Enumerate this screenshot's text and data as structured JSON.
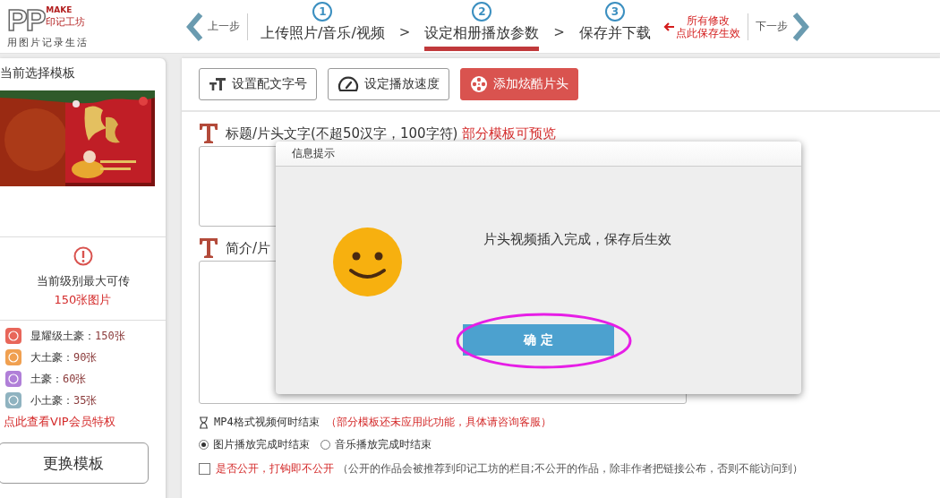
{
  "logo": {
    "letters": "PP",
    "make": "MAKE",
    "brand": "印记工坊",
    "slogan": "用图片记录生活"
  },
  "nav": {
    "prev": "上一步",
    "next": "下一步",
    "steps": [
      {
        "number": "1",
        "label": "上传照片/音乐/视频",
        "selected": false
      },
      {
        "number": "2",
        "label": "设定相册播放参数",
        "selected": true
      },
      {
        "number": "3",
        "label": "保存并下载",
        "selected": false
      }
    ],
    "separators": [
      ">",
      ">"
    ],
    "save_hint": [
      "所有修改",
      "点此保存生效"
    ]
  },
  "sidebar": {
    "title": "当前选择模板",
    "limit_text": "当前级别最大可传",
    "limit_count": "150张图片",
    "levels": [
      {
        "label": "显耀级土豪：",
        "count": "150张",
        "color": "#e8665a"
      },
      {
        "label": "大土豪：",
        "count": "90张",
        "color": "#f0a050"
      },
      {
        "label": "土豪：",
        "count": "60张",
        "color": "#b07fd8"
      },
      {
        "label": "小土豪：",
        "count": "35张",
        "color": "#8fb3c0"
      }
    ],
    "vip_link": "点此查看VIP会员特权",
    "change_button": "更换模板"
  },
  "toolbar": [
    {
      "kind": "font-size",
      "label": "设置配文字号",
      "selected": false
    },
    {
      "kind": "speed",
      "label": "设定播放速度",
      "selected": false
    },
    {
      "kind": "film",
      "label": "添加炫酷片头",
      "selected": true
    }
  ],
  "form": {
    "title_field": {
      "label": "标题/片头文字(不超50汉字，100字符)",
      "note": "部分模板可预览"
    },
    "intro_field": {
      "label": "简介/片"
    },
    "end_option": {
      "label": "MP4格式视频何时结束",
      "note": "（部分模板还未应用此功能，具体请咨询客服）",
      "options": [
        {
          "label": "图片播放完成时结束",
          "selected": true
        },
        {
          "label": "音乐播放完成时结束",
          "selected": false
        }
      ]
    },
    "public_option": {
      "label": "是否公开，打钩即不公开",
      "note": "（公开的作品会被推荐到印记工坊的栏目;不公开的作品，除非作者把链接公布，否则不能访问到）",
      "checked": false
    }
  },
  "dialog": {
    "title": "信息提示",
    "message": "片头视频插入完成，保存后生效",
    "button": "确 定",
    "highlighted": true
  }
}
